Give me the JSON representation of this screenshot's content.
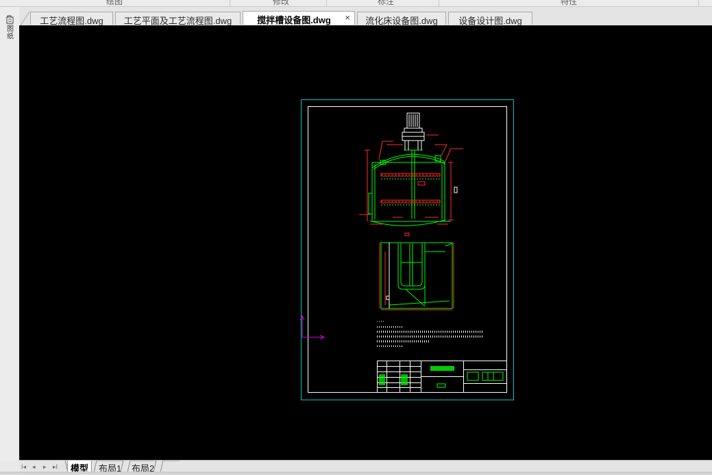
{
  "ribbon": {
    "groups": [
      "绘图",
      "修改",
      "标注",
      "特性"
    ]
  },
  "sidebar": {
    "label": "图纸"
  },
  "tabs": [
    {
      "label": "工艺流程图.dwg",
      "active": false
    },
    {
      "label": "工艺平面及工艺流程图.dwg",
      "active": false
    },
    {
      "label": "搅拌槽设备图.dwg",
      "active": true
    },
    {
      "label": "流化床设备图.dwg",
      "active": false
    },
    {
      "label": "设备设计图.dwg",
      "active": false
    }
  ],
  "close_glyph": "×",
  "layout_nav": {
    "first": "I◂",
    "prev": "◂",
    "next": "▸",
    "last": "▸I"
  },
  "layout_tabs": [
    {
      "label": "模型",
      "active": true
    },
    {
      "label": "布局1",
      "active": false
    },
    {
      "label": "布局2",
      "active": false
    }
  ],
  "colors": {
    "canvas_bg": "#000000",
    "sheet_border": "#00c8c8",
    "inner_frame": "#ffffff",
    "geometry": "#00ff00",
    "dimension": "#ff2d2d",
    "ucs": "#d400d4"
  }
}
